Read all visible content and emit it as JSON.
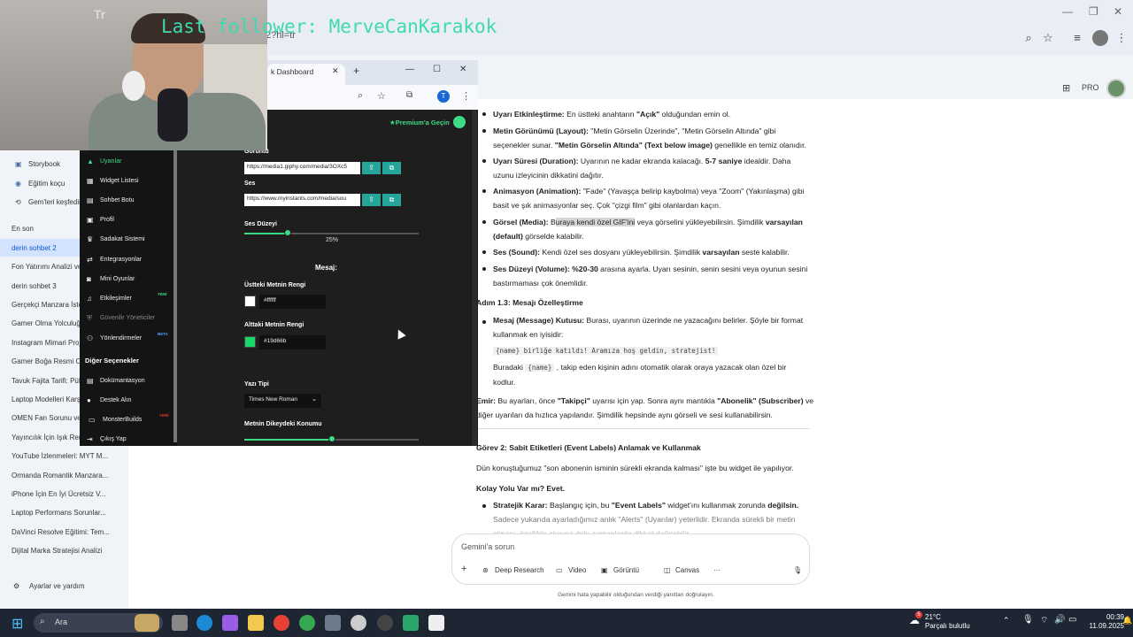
{
  "overlay": {
    "last_follower": "Last follower: MerveCanKarakok",
    "brand_logo": "Tr"
  },
  "browser_back": {
    "url_fragment": "2?hl=tr"
  },
  "gemini": {
    "pro_badge": "PRO",
    "sidebar": {
      "pinned": [
        {
          "label": "Storybook",
          "icon": "book-icon"
        },
        {
          "label": "Eğitim koçu",
          "icon": "coach-icon"
        },
        {
          "label": "Gem'leri keşfedin",
          "icon": "gem-icon"
        }
      ],
      "recent_heading": "En son",
      "chats": [
        "derin sohbet 2",
        "Fon Yatırımı Analizi ve D...",
        "derin sohbet 3",
        "Gerçekçi Manzara İste...",
        "Gamer Olma Yolculuğu...",
        "Instagram Mimari Proje...",
        "Gamer Boğa Resmi Olu...",
        "Tavuk Fajita Tarifi: Püf N...",
        "Laptop Modelleri Karşıl...",
        "OMEN Fan Sorunu ve Y...",
        "Yayıncılık İçin Işık Reng...",
        "YouTube İzlenmeleri: MYT M...",
        "Ormanda Romantik Manzara...",
        "iPhone İçin En İyi Ücretsiz V...",
        "Laptop Performans Sorunlar...",
        "DaVinci Resolve Eğitimi: Tem...",
        "Dijital Marka Stratejisi Analizi"
      ],
      "active_index": 0,
      "settings": "Ayarlar ve yardım"
    },
    "response": {
      "b1_label": "Uyarı Etkinleştirme:",
      "b1_text": " En üstteki anahtarın ",
      "b1_bold": "\"Açık\"",
      "b1_end": " olduğundan emin ol.",
      "b2_label": "Metin Görünümü (Layout):",
      "b2_text": " \"Metin Görselin Üzerinde\", \"Metin Görselin Altında\" gibi",
      "b2_line2a": "seçenekler sunar. ",
      "b2_bold": "\"Metin Görselin Altında\" (Text below image)",
      "b2_line2b": " genellikle en temiz olanıdır.",
      "b3_label": "Uyarı Süresi (Duration):",
      "b3_text": " Uyarının ne kadar ekranda kalacağı. ",
      "b3_bold": "5-7 saniye",
      "b3_end": " idealdir. Daha",
      "b3_line2": "uzunu izleyicinin dikkatini dağıtır.",
      "b4_label": "Animasyon (Animation):",
      "b4_text": " \"Fade\" (Yavaşça belirip kaybolma) veya \"Zoom\" (Yakınlaşma) gibi",
      "b4_line2": "basit ve şık animasyonlar seç. Çok \"çizgi film\" gibi olanlardan kaçın.",
      "b5_label": "Görsel (Media):",
      "b5_pre": " B",
      "b5_hl": "uraya kendi özel GIF'ini",
      "b5_text": " veya görselini yükleyebilirsin. Şimdilik ",
      "b5_bold": "varsayılan",
      "b5_bold2": "(default)",
      "b5_end": " görselde kalabilir.",
      "b6_label": "Ses (Sound):",
      "b6_text": " Kendi özel ses dosyanı yükleyebilirsin. Şimdilik ",
      "b6_bold": "varsayılan",
      "b6_end": " seste kalabilir.",
      "b7_label": "Ses Düzeyi (Volume):",
      "b7_bold": " %20-30",
      "b7_text": " arasına ayarla. Uyarı sesinin, senin sesini veya oyunun sesini",
      "b7_line2": "bastırmaması çok önemlidir.",
      "step13": "Adım 1.3: Mesajı Özelleştirme",
      "b8_label": "Mesaj (Message) Kutusu:",
      "b8_text": " Burası, uyarının üzerinde ne yazacağını belirler. Şöyle bir format",
      "b8_line2": "kullanmak en iyisidir:",
      "code_example": "{name} birliğe katıldı! Aramıza hoş geldin, stratejist!",
      "explain_pre": "Buradaki ",
      "explain_code": "{name}",
      "explain_text": " , takip eden kişinin adını otomatik olarak oraya yazacak olan özel bir",
      "explain_line2": "kodlur.",
      "emir_label": "Emir:",
      "emir_text": " Bu ayarları, önce ",
      "emir_bold": "\"Takipçi\"",
      "emir_mid": " uyarısı için yap. Sonra aynı mantıkla ",
      "emir_bold2": "\"Abonelik\" (Subscriber)",
      "emir_end": " ve",
      "emir_line2": "diğer uyarıları da hızlıca yapılandır. Şimdilik hepsinde aynı görseli ve sesi kullanabilirsin.",
      "task2": "Görev 2: Sabit Etiketleri (Event Labels) Anlamak ve Kullanmak",
      "task2_p": "Dün konuştuğumuz \"son abonenin isminin sürekli ekranda kalması\" işte bu widget ile yapılıyor.",
      "easy": "Kolay Yolu Var mı? Evet.",
      "b9_label": "Stratejik Karar:",
      "b9_text": " Başlangıç için, bu ",
      "b9_bold": "\"Event Labels\"",
      "b9_mid": " widget'ını kullanmak zorunda ",
      "b9_bold2": "değilsin.",
      "b9_line2": "Sadece yukarıda ayarladığımız anlık \"Alerts\" (Uyarılar) yeterlidir. Ekranda sürekli bir metin",
      "b9_line3": "olması, özellikle akışına dolu zamanlarda dikkat dağıtabilir."
    },
    "input": {
      "placeholder": "Gemini'a sorun"
    },
    "tools": [
      "Deep Research",
      "Video",
      "Görüntü",
      "Canvas",
      "···"
    ],
    "disclaimer": "Gemini hata yapabilir olduğundan verdiği yanıtları doğrulayın."
  },
  "popup": {
    "tab_title": "k Dashboard",
    "premium": "Premium'a Geçin",
    "sidebar": [
      {
        "label": "Uyarılar",
        "icon": "warning-icon",
        "active": true
      },
      {
        "label": "Widget Listesi",
        "icon": "widget-icon"
      },
      {
        "label": "Sohbet Botu",
        "icon": "bot-icon"
      },
      {
        "label": "Profil",
        "icon": "profile-icon"
      },
      {
        "label": "Sadakat Sistemi",
        "icon": "trophy-icon"
      },
      {
        "label": "Entegrasyonlar",
        "icon": "integration-icon"
      },
      {
        "label": "Mini Oyunlar",
        "icon": "gamepad-icon"
      },
      {
        "label": "Etkileşimler",
        "icon": "music-icon",
        "badge": "YENİ"
      },
      {
        "label": "Güvenilir Yöneticiler",
        "icon": "shield-icon",
        "muted": true
      },
      {
        "label": "Yönlendirmeler",
        "icon": "users-icon",
        "badge": "BETA"
      }
    ],
    "other_heading": "Diğer Seçenekler",
    "other": [
      {
        "label": "Dokümantasyon",
        "icon": "docs-icon"
      },
      {
        "label": "Destek Alın",
        "icon": "support-icon"
      },
      {
        "label": "MonsterBuilds",
        "icon": "monster-icon",
        "badge": "YENİ"
      },
      {
        "label": "Çıkış Yap",
        "icon": "logout-icon"
      }
    ],
    "form": {
      "image_label": "Görüntü",
      "image_url": "https://media1.giphy.com/media/3OXc5",
      "sound_label": "Ses",
      "sound_url": "https://www.myinstants.com/media/sou",
      "volume_label": "Ses Düzeyi",
      "volume_value": "25%",
      "volume_fraction": 0.25,
      "message_heading": "Mesaj:",
      "top_color_label": "Üstteki Metnin Rengi",
      "top_color": "#ffffff",
      "bottom_color_label": "Alttaki Metnin Rengi",
      "bottom_color": "#19d66b",
      "font_label": "Yazı Tipi",
      "font_value": "Times New Roman",
      "vertical_label": "Metnin Dikeydeki Konumu",
      "vertical_fraction": 0.5
    }
  },
  "taskbar": {
    "search": "Ara",
    "weather_temp": "21°C",
    "weather_desc": "Parçalı bulutlu",
    "weather_badge": "5",
    "time": "00:39",
    "date": "11.09.2025"
  }
}
